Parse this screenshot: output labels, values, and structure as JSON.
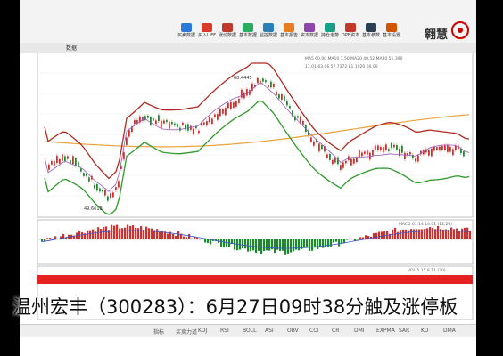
{
  "toolbar": {
    "buttons": [
      {
        "label": "买卖数据",
        "icon": "stock-icon",
        "color": "#2a7ad9"
      },
      {
        "label": "买入LIFF",
        "icon": "buy-icon",
        "color": "#d93a2a"
      },
      {
        "label": "涨价数据",
        "icon": "price-icon",
        "color": "#c0392b"
      },
      {
        "label": "基本数据",
        "icon": "data-icon",
        "color": "#27ae60"
      },
      {
        "label": "监控数据",
        "icon": "monitor-icon",
        "color": "#2980b9"
      },
      {
        "label": "基本报告",
        "icon": "report-icon",
        "color": "#e67e22"
      },
      {
        "label": "资本数据",
        "icon": "capital-icon",
        "color": "#8e44ad"
      },
      {
        "label": "持仓走势",
        "icon": "position-icon",
        "color": "#16a085"
      },
      {
        "label": "DPB资本",
        "icon": "dpb-icon",
        "color": "#c0392b"
      },
      {
        "label": "基本参数",
        "icon": "param-icon",
        "color": "#2c3e50"
      },
      {
        "label": "基本设置",
        "icon": "settings-icon",
        "color": "#d35400"
      }
    ],
    "brand": "翱慧"
  },
  "tab": {
    "label": "数据"
  },
  "legend": {
    "line1": "MA5 60.00  MA10 7.50  MA20 40.52  MA30 51.390",
    "line2": "11.01  63.06  57.7372  81.1920  60.00"
  },
  "price_labels": {
    "high": "68.4445",
    "low": "49.6618"
  },
  "macd_label": "MACD  61.14  14.01  (12,26)",
  "vol_label": "VOL  5.15  8.11  (30)",
  "statusbar": [
    "指标",
    "买卖力道",
    "KDJ",
    "RSI",
    "BOLL",
    "ASI",
    "OBV",
    "CCI",
    "CR",
    "DMI",
    "EXPMA",
    "SAR",
    "KD",
    "DMA"
  ],
  "headline": "温州宏丰（300283）：6月27日09时38分触及涨停板",
  "colors": {
    "up": "#d32f2f",
    "down": "#1e8a2e",
    "upper_band": "#b02a1f",
    "lower_band": "#2e9a2a",
    "ma_long": "#e8a33a",
    "ma_mid": "#9b59b6"
  }
}
